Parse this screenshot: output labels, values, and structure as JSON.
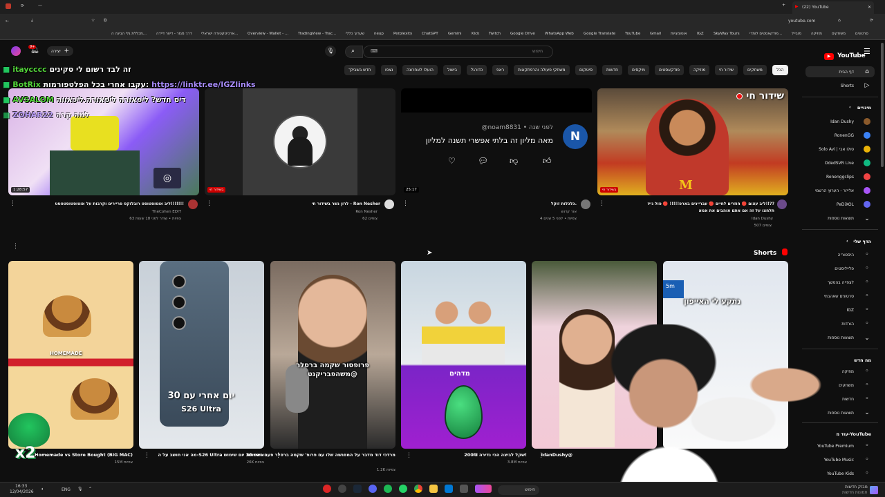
{
  "browser": {
    "tab_title": "(22) YouTube",
    "url": "youtube.com",
    "bookmarks": [
      "סרטונים",
      "משחקים",
      "מוזיקה",
      "מובייל",
      "פודקאסטים לומדי...",
      "SkyWay Tours",
      "IGZ",
      "אוטומציות",
      "Gmail",
      "YouTube",
      "Google Translate",
      "WhatsApp Web",
      "Google Drive",
      "Twitch",
      "Kick",
      "Gemini",
      "ChatGPT",
      "Perplexity",
      "neup",
      "שערוך כללי",
      "TradingView - Trac...",
      "Overview - Wallet - ...",
      "ארכיטקטורה ישראלי...",
      "דרך מגזר - דיוור דיידה",
      "מכללת גלי הבינה ה..."
    ]
  },
  "header": {
    "logo": "YouTube",
    "search_placeholder": "חיפוש",
    "create_label": "יצירה",
    "notification_count": "9+"
  },
  "chips": [
    {
      "label": "הכל",
      "active": true
    },
    {
      "label": "משחקים"
    },
    {
      "label": "שידור חי"
    },
    {
      "label": "מוזיקה"
    },
    {
      "label": "פודקאסטים"
    },
    {
      "label": "מיקסים"
    },
    {
      "label": "חדשות"
    },
    {
      "label": "סיטקום"
    },
    {
      "label": "משחקי פעולה והרפתקאות"
    },
    {
      "label": "ראפ"
    },
    {
      "label": "כדורגל"
    },
    {
      "label": "בישול"
    },
    {
      "label": "הועלו לאחרונה"
    },
    {
      "label": "נצפו"
    },
    {
      "label": "חדש בשבילך"
    }
  ],
  "sidebar": {
    "home": "דף הבית",
    "shorts": "Shorts",
    "subscriptions_header": "מינויים",
    "subscriptions": [
      "Idan Dushy",
      "RonenGG",
      "Solo Avi | סולו אבי",
      "OdedSVR Live",
      "Ronenggclips",
      "אלייזר - הערוץ הרשמי",
      "PeDiXOL"
    ],
    "show_more": "תוצאות נוספות",
    "you_header": "הדף שלי",
    "you_items": [
      "היסטוריה",
      "פלייליסטים",
      "לצפייה בהמשך",
      "סרטונים שאהבתי",
      "IGZ",
      "הורדות"
    ],
    "show_more2": "תוצאות נוספות",
    "explore_header": "מה חדש",
    "explore_items": [
      "מוזיקה",
      "משחקים",
      "חדשות"
    ],
    "show_more3": "תוצאות נוספות",
    "more_header": "עוד מ-YouTube",
    "more_items": [
      "YouTube Premium",
      "YouTube Music",
      "YouTube Kids"
    ]
  },
  "videos": [
    {
      "title": "ליב עצום 🔴 חוזרים לחיים 🔴 עבריינים בארפ!!!!! 🔴 פול גייז!!??",
      "title2": "תלחצו על זה אם אתם אוהבים את אמא",
      "channel": "Idan Dushy",
      "meta": "507 צופים",
      "badge": "בשידור חי",
      "live_label": "שידור חי"
    },
    {
      "title": "כלכלות זוקל.",
      "channel": "אור קדוש",
      "meta": "4 צפיות • לפני 5 שנים",
      "duration": "25:17",
      "comment_handle": "@noam8831",
      "comment_time": "לפני שנה",
      "comment_text": "מאה מליון זה בלתי אפשרי תשנה למליון"
    },
    {
      "title": "לרון נשר בשידור חי - Ron Nesher",
      "channel": "Ron Nesher",
      "meta": "62 צופים",
      "badge": "בשידור חי"
    },
    {
      "title": "ליב אוטוסטוסט רובלוקס פריירים וקרבות על אוטוסטוסטטטט!!!!!!!",
      "channel": "TheCohen EDIT",
      "meta": "63 צפיות • שודר לפני 18 שעות",
      "duration": "1:28:57"
    }
  ],
  "shorts_section": {
    "title": "Shorts",
    "items": [
      {
        "title": "נתקע לי האייפון",
        "views": ""
      },
      {
        "title": "IdanDushy@",
        "views": ""
      },
      {
        "title": "200₪ שקל לביצה הכי נדירה!",
        "views": "3.8M צפיות",
        "overlay": "מדהים"
      },
      {
        "title": "מרדכי דוד מדבר על המפגשה שלו עם פרופ' שקמה ברסלר פעם ראשונה",
        "views": "1.2K צפיות",
        "overlay": "פרופסור שקמה ברסלר @משהפבריקנט"
      },
      {
        "title": "מה אני חושב על ה-S26 Ultra אחרי 30 יום שימוש",
        "views": "26K צפיות",
        "overlay": "30 יום אחרי עם",
        "overlay2": "S26 Ultra"
      },
      {
        "title": "Homemade vs Store Bought (BIG MAC)",
        "views": "15M צפיות",
        "overlay": "HOMEMADE"
      }
    ]
  },
  "stream_overlay": {
    "line1_user": "itaycccc",
    "line1_text": "זה לבד רשום לי סקינים",
    "line2_user": "BotRix",
    "line2_text": "עקבו אחרי בכל הפלטפורמות:",
    "line2_link": "https://linktr.ee/IGZlinks",
    "line3_user": "AVSALOM",
    "line3_text": "דיס חדש? ליפאורה ליפאורה.ליכאווה",
    "line4_user": "ZOHAR22",
    "line4_text": "למה קרה",
    "multiplier": "x2"
  },
  "taskbar": {
    "time": "16:33",
    "date": "12/04/2026",
    "lang": "ENG",
    "search": "חיפוש",
    "weather": "מבזק חדשות",
    "weather2": "תמונות חדשות"
  }
}
